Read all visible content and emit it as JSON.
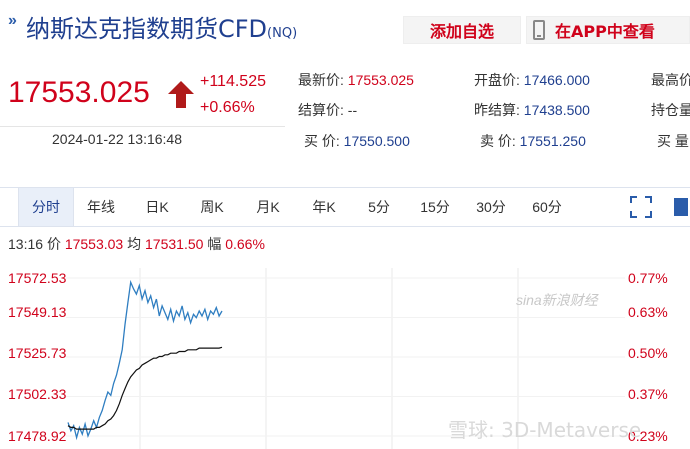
{
  "header": {
    "title": "纳斯达克指数期货CFD",
    "code": "(NQ)",
    "add_favorite": "添加自选",
    "view_in_app": "在APP中查看"
  },
  "quote": {
    "price": "17553.025",
    "change": "+114.525",
    "change_pct": "+0.66%",
    "datetime": "2024-01-22 13:16:48",
    "fields": {
      "latest_label": "最新价:",
      "latest_value": "17553.025",
      "open_label": "开盘价:",
      "open_value": "17466.000",
      "high_label": "最高价",
      "settle_label": "结算价:",
      "settle_value": "--",
      "prev_settle_label": "昨结算:",
      "prev_settle_value": "17438.500",
      "position_label": "持仓量",
      "bid_label": "买  价:",
      "bid_value": "17550.500",
      "ask_label": "卖  价:",
      "ask_value": "17551.250",
      "bid_vol_label": "买  量"
    }
  },
  "tabs": [
    "分时",
    "年线",
    "日K",
    "周K",
    "月K",
    "年K",
    "5分",
    "15分",
    "30分",
    "60分"
  ],
  "info_line": {
    "time": "13:16",
    "price_label": "价",
    "price_value": "17553.03",
    "avg_label": "均",
    "avg_value": "17531.50",
    "amp_label": "幅",
    "amp_value": "0.66%"
  },
  "chart": {
    "left_labels": [
      "17572.53",
      "17549.13",
      "17525.73",
      "17502.33",
      "17478.92"
    ],
    "right_labels": [
      "0.77%",
      "0.63%",
      "0.50%",
      "0.37%",
      "0.23%"
    ],
    "watermark": "sina新浪财经",
    "watermark2": "雪球: 3D-Metaverse"
  },
  "chart_data": {
    "type": "line",
    "ylim": [
      17478.92,
      17572.53
    ],
    "y_ticks": [
      17478.92,
      17502.33,
      17525.73,
      17549.13,
      17572.53
    ],
    "pct_ticks": [
      "0.23%",
      "0.37%",
      "0.50%",
      "0.63%",
      "0.77%"
    ],
    "series": [
      {
        "values": [
          17487,
          17482,
          17485,
          17478,
          17484,
          17480,
          17486,
          17479,
          17483,
          17488,
          17484,
          17490,
          17494,
          17500,
          17505,
          17503,
          17510,
          17515,
          17522,
          17530,
          17545,
          17558,
          17570,
          17566,
          17563,
          17568,
          17560,
          17565,
          17558,
          17562,
          17555,
          17560,
          17550,
          17556,
          17552,
          17548,
          17554,
          17547,
          17553,
          17550,
          17556,
          17548,
          17552,
          17546,
          17551,
          17549,
          17553,
          17550,
          17554,
          17548,
          17553,
          17551,
          17555,
          17550,
          17553
        ]
      },
      {
        "values": [
          17485,
          17484,
          17484,
          17483,
          17483,
          17483,
          17483,
          17483,
          17483,
          17483,
          17484,
          17484,
          17485,
          17486,
          17488,
          17489,
          17491,
          17494,
          17498,
          17503,
          17507,
          17511,
          17514,
          17516,
          17518,
          17519,
          17521,
          17522,
          17523,
          17524,
          17525,
          17525,
          17526,
          17526,
          17527,
          17527,
          17528,
          17528,
          17528,
          17529,
          17529,
          17529,
          17530,
          17530,
          17530,
          17530,
          17531,
          17531,
          17531,
          17531,
          17531,
          17531,
          17531,
          17531,
          17531.5
        ]
      }
    ]
  }
}
